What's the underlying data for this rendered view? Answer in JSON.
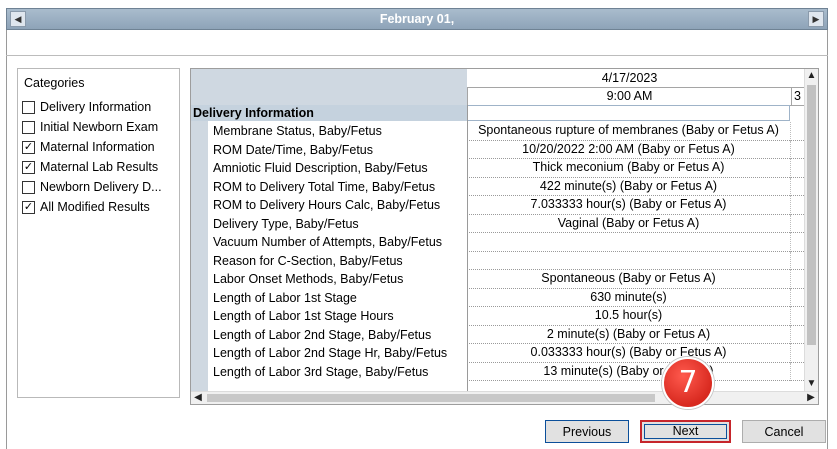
{
  "header": {
    "date_title": "February 01,",
    "prev_icon": "◀",
    "next_icon": "▶"
  },
  "categories": {
    "title": "Categories",
    "items": [
      {
        "label": "Delivery Information",
        "checked": false
      },
      {
        "label": "Initial Newborn Exam",
        "checked": false
      },
      {
        "label": "Maternal Information",
        "checked": true
      },
      {
        "label": "Maternal Lab Results",
        "checked": true
      },
      {
        "label": "Newborn Delivery D...",
        "checked": false
      },
      {
        "label": "All Modified Results",
        "checked": true
      }
    ]
  },
  "grid": {
    "date": "4/17/2023",
    "time": "9:00 AM",
    "next_time_partial": "3",
    "section": "Delivery Information",
    "rows": [
      {
        "label": "Membrane Status, Baby/Fetus",
        "value": "Spontaneous rupture of membranes (Baby or Fetus A)"
      },
      {
        "label": "ROM Date/Time, Baby/Fetus",
        "value": "10/20/2022 2:00 AM (Baby or Fetus A)"
      },
      {
        "label": "Amniotic Fluid Description, Baby/Fetus",
        "value": "Thick meconium (Baby or Fetus A)"
      },
      {
        "label": "ROM to Delivery Total Time, Baby/Fetus",
        "value": "422 minute(s) (Baby or Fetus A)"
      },
      {
        "label": "ROM to Delivery Hours Calc, Baby/Fetus",
        "value": "7.033333 hour(s) (Baby or Fetus A)"
      },
      {
        "label": "Delivery Type, Baby/Fetus",
        "value": "Vaginal (Baby or Fetus A)"
      },
      {
        "label": "Vacuum Number of Attempts, Baby/Fetus",
        "value": ""
      },
      {
        "label": "Reason for C-Section, Baby/Fetus",
        "value": ""
      },
      {
        "label": "Labor Onset Methods, Baby/Fetus",
        "value": "Spontaneous (Baby or Fetus A)"
      },
      {
        "label": "Length of Labor 1st Stage",
        "value": "630 minute(s)"
      },
      {
        "label": "Length of Labor 1st Stage Hours",
        "value": "10.5 hour(s)"
      },
      {
        "label": "Length of Labor 2nd Stage, Baby/Fetus",
        "value": "2 minute(s) (Baby or Fetus A)"
      },
      {
        "label": "Length of Labor 2nd Stage Hr, Baby/Fetus",
        "value": "0.033333 hour(s) (Baby or Fetus A)"
      },
      {
        "label": "Length of Labor 3rd Stage, Baby/Fetus",
        "value": "13 minute(s) (Baby or Fetus A)"
      }
    ]
  },
  "buttons": {
    "previous": "Previous",
    "next": "Next",
    "cancel": "Cancel"
  },
  "callout": {
    "step_number": "7",
    "color": "#d8291f"
  },
  "colors": {
    "header_bar": "#a9bccd",
    "highlight_border": "#c6252b",
    "focus_border": "#0b4f9a"
  }
}
